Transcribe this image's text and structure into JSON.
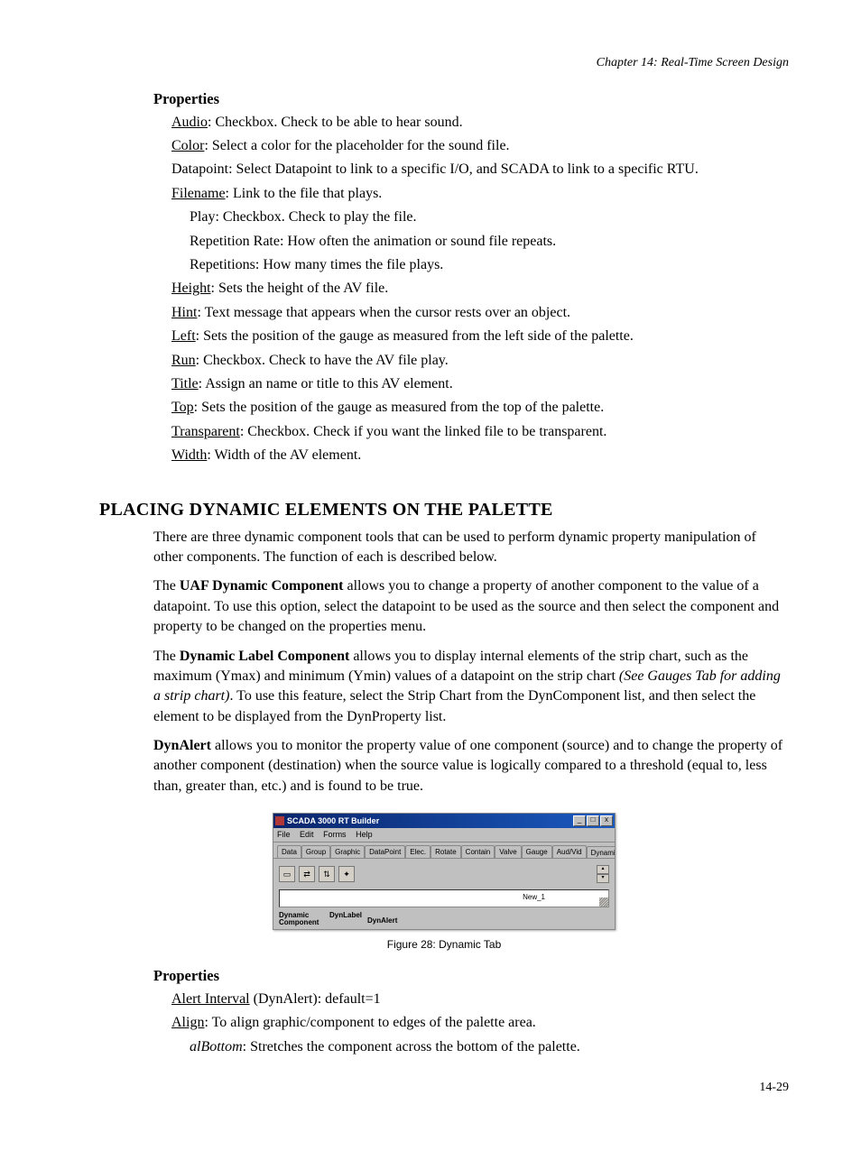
{
  "header": {
    "chapter": "Chapter 14: Real-Time Screen Design"
  },
  "properties1": {
    "heading": "Properties",
    "items": [
      {
        "label": "Audio",
        "text": ": Checkbox.  Check to be able to hear sound."
      },
      {
        "label": "Color",
        "text": ": Select a color for the placeholder for the sound file."
      },
      {
        "label": "Datapoint",
        "text": ":  Select Datapoint to link to a specific I/O, and SCADA to link to a specific RTU."
      },
      {
        "label": "Filename",
        "text": ": Link to the file that plays."
      }
    ],
    "filename_subs": [
      "Play: Checkbox. Check to play the file.",
      "Repetition Rate: How often the animation or sound file repeats.",
      "Repetitions: How many times the file plays."
    ],
    "items2": [
      {
        "label": "Height",
        "text": ": Sets the height of the AV file."
      },
      {
        "label": "Hint",
        "text": ": Text message that appears when the cursor rests over an object."
      },
      {
        "label": "Left",
        "text": ": Sets the position of the gauge as measured from the left side of the palette."
      },
      {
        "label": "Run",
        "text": ": Checkbox.  Check to have the AV file play."
      },
      {
        "label": "Title",
        "text": ": Assign an name or title to this AV element."
      },
      {
        "label": "Top",
        "text": ": Sets the position of the gauge as measured from the top of the palette."
      },
      {
        "label": "Transparent",
        "text": ": Checkbox. Check if you want the linked file to be transparent."
      },
      {
        "label": "Width",
        "text": ": Width of the AV element."
      }
    ]
  },
  "section": {
    "title": "PLACING DYNAMIC ELEMENTS ON THE PALETTE",
    "para1": "There are three dynamic component tools that can be used to perform dynamic property manipulation of other components. The function of each is described below.",
    "para2_a": "The ",
    "para2_bold": "UAF Dynamic Component",
    "para2_b": " allows you to change a property of another component to the value of a datapoint. To use this option, select the datapoint to be used as the source and then select the component and property to be changed on the properties menu.",
    "para3_a": "The ",
    "para3_bold": "Dynamic Label Component",
    "para3_b": " allows you to display internal elements of the strip chart, such as the maximum (Ymax) and minimum (Ymin) values of a datapoint on the strip chart ",
    "para3_ital": "(See Gauges Tab for adding a strip chart)",
    "para3_c": ". To use this feature, select the Strip Chart from the DynComponent list, and then select the element to be displayed from the DynProperty list.",
    "para4_bold": "DynAlert",
    "para4_a": " allows you to monitor the property value of one component (source) and to change the property of another component (destination) when the source value is logically compared to a threshold (equal to, less than, greater than, etc.) and is found to be true."
  },
  "figure": {
    "caption": "Figure 28: Dynamic Tab",
    "window_title": "SCADA 3000 RT Builder",
    "menus": [
      "File",
      "Edit",
      "Forms",
      "Help"
    ],
    "tabs": [
      "Data",
      "Group",
      "Graphic",
      "DataPoint",
      "Elec.",
      "Rotate",
      "Contain",
      "Valve",
      "Gauge",
      "Aud/Vid",
      "Dynamic"
    ],
    "grid_label": "New_1",
    "tool_labels": [
      "Dynamic Component",
      "DynLabel",
      "DynAlert"
    ]
  },
  "properties2": {
    "heading": "Properties",
    "items": [
      {
        "label": "Alert Interval",
        "suffix": " (DynAlert): default=1"
      },
      {
        "label": "Align",
        "suffix": ": To align graphic/component to edges of the palette area."
      }
    ],
    "sub": {
      "label": "alBottom",
      "text": ": Stretches the component across the bottom of the palette."
    }
  },
  "page_number": "14-29"
}
